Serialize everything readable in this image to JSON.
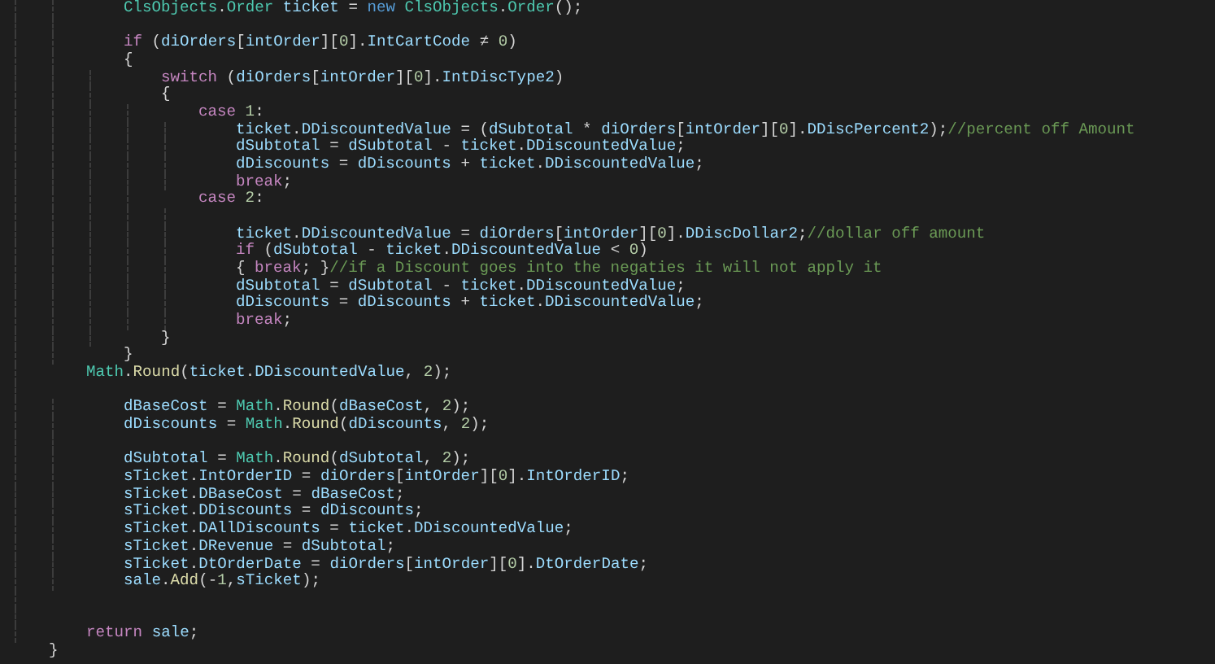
{
  "editor": {
    "lines": [
      {
        "kind": "group",
        "children": [
          {
            "kind": "group",
            "children": [
              {
                "kind": "code",
                "tokens": [
                  {
                    "kind": "type",
                    "text": "ClsObjects"
                  },
                  {
                    "kind": "plain",
                    "text": "."
                  },
                  {
                    "kind": "type",
                    "text": "Order"
                  },
                  {
                    "kind": "name",
                    "text": " ticket"
                  },
                  {
                    "kind": "plain",
                    "text": " = "
                  },
                  {
                    "kind": "keyword",
                    "text": "new "
                  },
                  {
                    "kind": "type",
                    "text": "ClsObjects"
                  },
                  {
                    "kind": "plain",
                    "text": "."
                  },
                  {
                    "kind": "type",
                    "text": "Order"
                  },
                  {
                    "kind": "plain",
                    "text": "();"
                  }
                ]
              },
              {
                "kind": "blank"
              },
              {
                "kind": "code",
                "tokens": [
                  {
                    "kind": "control",
                    "text": "if"
                  },
                  {
                    "kind": "plain",
                    "text": " ("
                  },
                  {
                    "kind": "name",
                    "text": "diOrders"
                  },
                  {
                    "kind": "plain",
                    "text": "["
                  },
                  {
                    "kind": "name",
                    "text": "intOrder"
                  },
                  {
                    "kind": "plain",
                    "text": "]["
                  },
                  {
                    "kind": "number",
                    "text": "0"
                  },
                  {
                    "kind": "plain",
                    "text": "]."
                  },
                  {
                    "kind": "name",
                    "text": "IntCartCode"
                  },
                  {
                    "kind": "plain",
                    "text": " ≠ "
                  },
                  {
                    "kind": "number",
                    "text": "0"
                  },
                  {
                    "kind": "plain",
                    "text": ")"
                  }
                ]
              },
              {
                "kind": "code",
                "tokens": [
                  {
                    "kind": "plain",
                    "text": "{"
                  }
                ],
                "children": [
                  {
                    "kind": "code",
                    "tokens": [
                      {
                        "kind": "control",
                        "text": "switch"
                      },
                      {
                        "kind": "plain",
                        "text": " ("
                      },
                      {
                        "kind": "name",
                        "text": "diOrders"
                      },
                      {
                        "kind": "plain",
                        "text": "["
                      },
                      {
                        "kind": "name",
                        "text": "intOrder"
                      },
                      {
                        "kind": "plain",
                        "text": "]["
                      },
                      {
                        "kind": "number",
                        "text": "0"
                      },
                      {
                        "kind": "plain",
                        "text": "]."
                      },
                      {
                        "kind": "name",
                        "text": "IntDiscType2"
                      },
                      {
                        "kind": "plain",
                        "text": ")"
                      }
                    ]
                  },
                  {
                    "kind": "code",
                    "tokens": [
                      {
                        "kind": "plain",
                        "text": "{"
                      }
                    ],
                    "children": [
                      {
                        "kind": "code",
                        "tokens": [
                          {
                            "kind": "control",
                            "text": "case "
                          },
                          {
                            "kind": "number",
                            "text": "1"
                          },
                          {
                            "kind": "plain",
                            "text": ":"
                          }
                        ],
                        "children": [
                          {
                            "kind": "code",
                            "tokens": [
                              {
                                "kind": "name",
                                "text": "ticket"
                              },
                              {
                                "kind": "plain",
                                "text": "."
                              },
                              {
                                "kind": "name",
                                "text": "DDiscountedValue"
                              },
                              {
                                "kind": "plain",
                                "text": " = ("
                              },
                              {
                                "kind": "name",
                                "text": "dSubtotal"
                              },
                              {
                                "kind": "plain",
                                "text": " * "
                              },
                              {
                                "kind": "name",
                                "text": "diOrders"
                              },
                              {
                                "kind": "plain",
                                "text": "["
                              },
                              {
                                "kind": "name",
                                "text": "intOrder"
                              },
                              {
                                "kind": "plain",
                                "text": "]["
                              },
                              {
                                "kind": "number",
                                "text": "0"
                              },
                              {
                                "kind": "plain",
                                "text": "]."
                              },
                              {
                                "kind": "name",
                                "text": "DDiscPercent2"
                              },
                              {
                                "kind": "plain",
                                "text": ");"
                              },
                              {
                                "kind": "comment",
                                "text": "//percent off Amount"
                              }
                            ]
                          },
                          {
                            "kind": "code",
                            "tokens": [
                              {
                                "kind": "name",
                                "text": "dSubtotal"
                              },
                              {
                                "kind": "plain",
                                "text": " = "
                              },
                              {
                                "kind": "name",
                                "text": "dSubtotal"
                              },
                              {
                                "kind": "plain",
                                "text": " - "
                              },
                              {
                                "kind": "name",
                                "text": "ticket"
                              },
                              {
                                "kind": "plain",
                                "text": "."
                              },
                              {
                                "kind": "name",
                                "text": "DDiscountedValue"
                              },
                              {
                                "kind": "plain",
                                "text": ";"
                              }
                            ]
                          },
                          {
                            "kind": "code",
                            "tokens": [
                              {
                                "kind": "name",
                                "text": "dDiscounts"
                              },
                              {
                                "kind": "plain",
                                "text": " = "
                              },
                              {
                                "kind": "name",
                                "text": "dDiscounts"
                              },
                              {
                                "kind": "plain",
                                "text": " + "
                              },
                              {
                                "kind": "name",
                                "text": "ticket"
                              },
                              {
                                "kind": "plain",
                                "text": "."
                              },
                              {
                                "kind": "name",
                                "text": "DDiscountedValue"
                              },
                              {
                                "kind": "plain",
                                "text": ";"
                              }
                            ]
                          },
                          {
                            "kind": "code",
                            "tokens": [
                              {
                                "kind": "control",
                                "text": "break"
                              },
                              {
                                "kind": "plain",
                                "text": ";"
                              }
                            ]
                          }
                        ]
                      },
                      {
                        "kind": "code",
                        "tokens": [
                          {
                            "kind": "control",
                            "text": "case "
                          },
                          {
                            "kind": "number",
                            "text": "2"
                          },
                          {
                            "kind": "plain",
                            "text": ":"
                          }
                        ],
                        "children": [
                          {
                            "kind": "blank"
                          },
                          {
                            "kind": "code",
                            "tokens": [
                              {
                                "kind": "name",
                                "text": "ticket"
                              },
                              {
                                "kind": "plain",
                                "text": "."
                              },
                              {
                                "kind": "name",
                                "text": "DDiscountedValue"
                              },
                              {
                                "kind": "plain",
                                "text": " = "
                              },
                              {
                                "kind": "name",
                                "text": "diOrders"
                              },
                              {
                                "kind": "plain",
                                "text": "["
                              },
                              {
                                "kind": "name",
                                "text": "intOrder"
                              },
                              {
                                "kind": "plain",
                                "text": "]["
                              },
                              {
                                "kind": "number",
                                "text": "0"
                              },
                              {
                                "kind": "plain",
                                "text": "]."
                              },
                              {
                                "kind": "name",
                                "text": "DDiscDollar2"
                              },
                              {
                                "kind": "plain",
                                "text": ";"
                              },
                              {
                                "kind": "comment",
                                "text": "//dollar off amount"
                              }
                            ]
                          },
                          {
                            "kind": "code",
                            "tokens": [
                              {
                                "kind": "control",
                                "text": "if"
                              },
                              {
                                "kind": "plain",
                                "text": " ("
                              },
                              {
                                "kind": "name",
                                "text": "dSubtotal"
                              },
                              {
                                "kind": "plain",
                                "text": " - "
                              },
                              {
                                "kind": "name",
                                "text": "ticket"
                              },
                              {
                                "kind": "plain",
                                "text": "."
                              },
                              {
                                "kind": "name",
                                "text": "DDiscountedValue"
                              },
                              {
                                "kind": "plain",
                                "text": " < "
                              },
                              {
                                "kind": "number",
                                "text": "0"
                              },
                              {
                                "kind": "plain",
                                "text": ")"
                              }
                            ]
                          },
                          {
                            "kind": "code",
                            "tokens": [
                              {
                                "kind": "plain",
                                "text": "{ "
                              },
                              {
                                "kind": "control",
                                "text": "break"
                              },
                              {
                                "kind": "plain",
                                "text": "; }"
                              },
                              {
                                "kind": "comment",
                                "text": "//if a Discount goes into the negaties it will not apply it"
                              }
                            ]
                          },
                          {
                            "kind": "code",
                            "tokens": [
                              {
                                "kind": "name",
                                "text": "dSubtotal"
                              },
                              {
                                "kind": "plain",
                                "text": " = "
                              },
                              {
                                "kind": "name",
                                "text": "dSubtotal"
                              },
                              {
                                "kind": "plain",
                                "text": " - "
                              },
                              {
                                "kind": "name",
                                "text": "ticket"
                              },
                              {
                                "kind": "plain",
                                "text": "."
                              },
                              {
                                "kind": "name",
                                "text": "DDiscountedValue"
                              },
                              {
                                "kind": "plain",
                                "text": ";"
                              }
                            ]
                          },
                          {
                            "kind": "code",
                            "tokens": [
                              {
                                "kind": "name",
                                "text": "dDiscounts"
                              },
                              {
                                "kind": "plain",
                                "text": " = "
                              },
                              {
                                "kind": "name",
                                "text": "dDiscounts"
                              },
                              {
                                "kind": "plain",
                                "text": " + "
                              },
                              {
                                "kind": "name",
                                "text": "ticket"
                              },
                              {
                                "kind": "plain",
                                "text": "."
                              },
                              {
                                "kind": "name",
                                "text": "DDiscountedValue"
                              },
                              {
                                "kind": "plain",
                                "text": ";"
                              }
                            ]
                          },
                          {
                            "kind": "code",
                            "tokens": [
                              {
                                "kind": "control",
                                "text": "break"
                              },
                              {
                                "kind": "plain",
                                "text": ";"
                              }
                            ]
                          }
                        ]
                      }
                    ]
                  },
                  {
                    "kind": "code",
                    "tokens": [
                      {
                        "kind": "plain",
                        "text": "}"
                      }
                    ]
                  }
                ]
              },
              {
                "kind": "code",
                "tokens": [
                  {
                    "kind": "plain",
                    "text": "}"
                  }
                ]
              }
            ]
          },
          {
            "kind": "code",
            "tokens": [
              {
                "kind": "type",
                "text": "Math"
              },
              {
                "kind": "plain",
                "text": "."
              },
              {
                "kind": "call",
                "text": "Round"
              },
              {
                "kind": "plain",
                "text": "("
              },
              {
                "kind": "name",
                "text": "ticket"
              },
              {
                "kind": "plain",
                "text": "."
              },
              {
                "kind": "name",
                "text": "DDiscountedValue"
              },
              {
                "kind": "plain",
                "text": ", "
              },
              {
                "kind": "number",
                "text": "2"
              },
              {
                "kind": "plain",
                "text": ");"
              }
            ]
          },
          {
            "kind": "blank"
          },
          {
            "kind": "group",
            "children": [
              {
                "kind": "code",
                "tokens": [
                  {
                    "kind": "name",
                    "text": "dBaseCost"
                  },
                  {
                    "kind": "plain",
                    "text": " = "
                  },
                  {
                    "kind": "type",
                    "text": "Math"
                  },
                  {
                    "kind": "plain",
                    "text": "."
                  },
                  {
                    "kind": "call",
                    "text": "Round"
                  },
                  {
                    "kind": "plain",
                    "text": "("
                  },
                  {
                    "kind": "name",
                    "text": "dBaseCost"
                  },
                  {
                    "kind": "plain",
                    "text": ", "
                  },
                  {
                    "kind": "number",
                    "text": "2"
                  },
                  {
                    "kind": "plain",
                    "text": ");"
                  }
                ]
              },
              {
                "kind": "code",
                "tokens": [
                  {
                    "kind": "name",
                    "text": "dDiscounts"
                  },
                  {
                    "kind": "plain",
                    "text": " = "
                  },
                  {
                    "kind": "type",
                    "text": "Math"
                  },
                  {
                    "kind": "plain",
                    "text": "."
                  },
                  {
                    "kind": "call",
                    "text": "Round"
                  },
                  {
                    "kind": "plain",
                    "text": "("
                  },
                  {
                    "kind": "name",
                    "text": "dDiscounts"
                  },
                  {
                    "kind": "plain",
                    "text": ", "
                  },
                  {
                    "kind": "number",
                    "text": "2"
                  },
                  {
                    "kind": "plain",
                    "text": ");"
                  }
                ]
              },
              {
                "kind": "blank"
              },
              {
                "kind": "code",
                "tokens": [
                  {
                    "kind": "name",
                    "text": "dSubtotal"
                  },
                  {
                    "kind": "plain",
                    "text": " = "
                  },
                  {
                    "kind": "type",
                    "text": "Math"
                  },
                  {
                    "kind": "plain",
                    "text": "."
                  },
                  {
                    "kind": "call",
                    "text": "Round"
                  },
                  {
                    "kind": "plain",
                    "text": "("
                  },
                  {
                    "kind": "name",
                    "text": "dSubtotal"
                  },
                  {
                    "kind": "plain",
                    "text": ", "
                  },
                  {
                    "kind": "number",
                    "text": "2"
                  },
                  {
                    "kind": "plain",
                    "text": ");"
                  }
                ]
              },
              {
                "kind": "code",
                "tokens": [
                  {
                    "kind": "name",
                    "text": "sTicket"
                  },
                  {
                    "kind": "plain",
                    "text": "."
                  },
                  {
                    "kind": "name",
                    "text": "IntOrderID"
                  },
                  {
                    "kind": "plain",
                    "text": " = "
                  },
                  {
                    "kind": "name",
                    "text": "diOrders"
                  },
                  {
                    "kind": "plain",
                    "text": "["
                  },
                  {
                    "kind": "name",
                    "text": "intOrder"
                  },
                  {
                    "kind": "plain",
                    "text": "]["
                  },
                  {
                    "kind": "number",
                    "text": "0"
                  },
                  {
                    "kind": "plain",
                    "text": "]."
                  },
                  {
                    "kind": "name",
                    "text": "IntOrderID"
                  },
                  {
                    "kind": "plain",
                    "text": ";"
                  }
                ]
              },
              {
                "kind": "code",
                "tokens": [
                  {
                    "kind": "name",
                    "text": "sTicket"
                  },
                  {
                    "kind": "plain",
                    "text": "."
                  },
                  {
                    "kind": "name",
                    "text": "DBaseCost"
                  },
                  {
                    "kind": "plain",
                    "text": " = "
                  },
                  {
                    "kind": "name",
                    "text": "dBaseCost"
                  },
                  {
                    "kind": "plain",
                    "text": ";"
                  }
                ]
              },
              {
                "kind": "code",
                "tokens": [
                  {
                    "kind": "name",
                    "text": "sTicket"
                  },
                  {
                    "kind": "plain",
                    "text": "."
                  },
                  {
                    "kind": "name",
                    "text": "DDiscounts"
                  },
                  {
                    "kind": "plain",
                    "text": " = "
                  },
                  {
                    "kind": "name",
                    "text": "dDiscounts"
                  },
                  {
                    "kind": "plain",
                    "text": ";"
                  }
                ]
              },
              {
                "kind": "code",
                "tokens": [
                  {
                    "kind": "name",
                    "text": "sTicket"
                  },
                  {
                    "kind": "plain",
                    "text": "."
                  },
                  {
                    "kind": "name",
                    "text": "DAllDiscounts"
                  },
                  {
                    "kind": "plain",
                    "text": " = "
                  },
                  {
                    "kind": "name",
                    "text": "ticket"
                  },
                  {
                    "kind": "plain",
                    "text": "."
                  },
                  {
                    "kind": "name",
                    "text": "DDiscountedValue"
                  },
                  {
                    "kind": "plain",
                    "text": ";"
                  }
                ]
              },
              {
                "kind": "code",
                "tokens": [
                  {
                    "kind": "name",
                    "text": "sTicket"
                  },
                  {
                    "kind": "plain",
                    "text": "."
                  },
                  {
                    "kind": "name",
                    "text": "DRevenue"
                  },
                  {
                    "kind": "plain",
                    "text": " = "
                  },
                  {
                    "kind": "name",
                    "text": "dSubtotal"
                  },
                  {
                    "kind": "plain",
                    "text": ";"
                  }
                ]
              },
              {
                "kind": "code",
                "tokens": [
                  {
                    "kind": "name",
                    "text": "sTicket"
                  },
                  {
                    "kind": "plain",
                    "text": "."
                  },
                  {
                    "kind": "name",
                    "text": "DtOrderDate"
                  },
                  {
                    "kind": "plain",
                    "text": " = "
                  },
                  {
                    "kind": "name",
                    "text": "diOrders"
                  },
                  {
                    "kind": "plain",
                    "text": "["
                  },
                  {
                    "kind": "name",
                    "text": "intOrder"
                  },
                  {
                    "kind": "plain",
                    "text": "]["
                  },
                  {
                    "kind": "number",
                    "text": "0"
                  },
                  {
                    "kind": "plain",
                    "text": "]."
                  },
                  {
                    "kind": "name",
                    "text": "DtOrderDate"
                  },
                  {
                    "kind": "plain",
                    "text": ";"
                  }
                ]
              },
              {
                "kind": "code",
                "tokens": [
                  {
                    "kind": "name",
                    "text": "sale"
                  },
                  {
                    "kind": "plain",
                    "text": "."
                  },
                  {
                    "kind": "call",
                    "text": "Add"
                  },
                  {
                    "kind": "plain",
                    "text": "(-"
                  },
                  {
                    "kind": "number",
                    "text": "1"
                  },
                  {
                    "kind": "plain",
                    "text": ","
                  },
                  {
                    "kind": "name",
                    "text": "sTicket"
                  },
                  {
                    "kind": "plain",
                    "text": ");"
                  }
                ]
              }
            ]
          },
          {
            "kind": "blank"
          },
          {
            "kind": "blank"
          },
          {
            "kind": "code",
            "tokens": [
              {
                "kind": "control",
                "text": "return "
              },
              {
                "kind": "name",
                "text": "sale"
              },
              {
                "kind": "plain",
                "text": ";"
              }
            ]
          }
        ]
      },
      {
        "kind": "code",
        "tokens": [
          {
            "kind": "plain",
            "text": "}"
          }
        ]
      }
    ]
  }
}
